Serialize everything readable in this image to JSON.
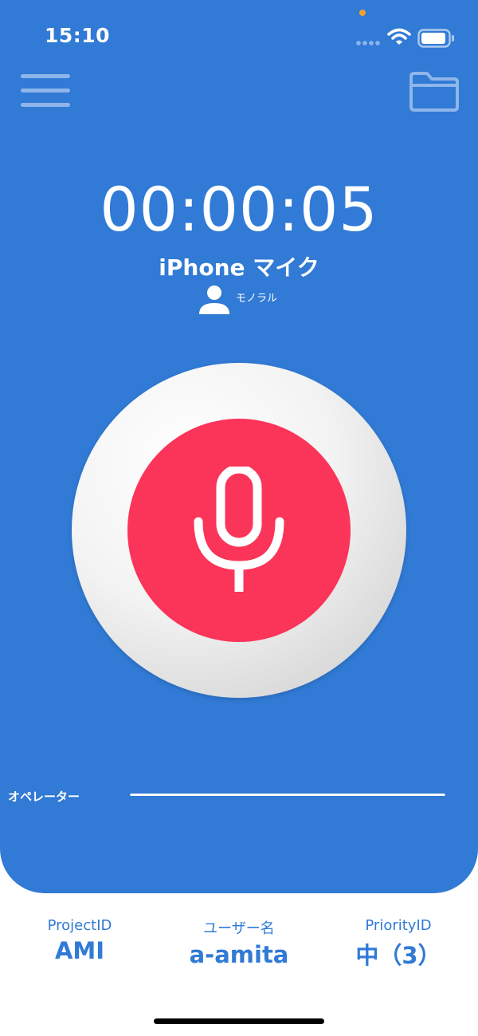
{
  "status_bar": {
    "time": "15:10"
  },
  "header": {
    "menu_icon": "hamburger-menu-icon",
    "folder_icon": "folder-icon"
  },
  "recorder": {
    "elapsed": "00:00:05",
    "device": "iPhone マイク",
    "channel": "モノラル",
    "record_icon": "microphone-icon"
  },
  "operator": {
    "label": "オペレーター"
  },
  "info": {
    "project_label": "ProjectID",
    "project_value": "AMI",
    "user_label": "ユーザー名",
    "user_value": "a-amita",
    "priority_label": "PriorityID",
    "priority_value": "中（3）"
  },
  "colors": {
    "primary_blue": "#317ad5",
    "record_red": "#fb3459",
    "white": "#ffffff"
  }
}
